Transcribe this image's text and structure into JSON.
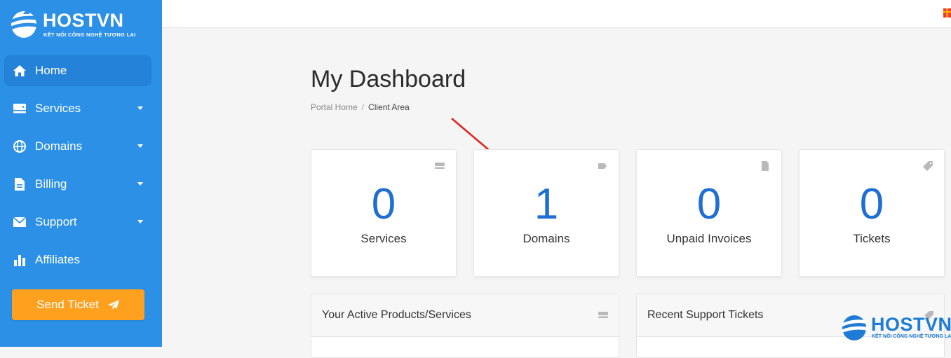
{
  "brand": {
    "name": "HOSTVN",
    "tagline": "KẾT NỐI CÔNG NGHỆ TƯƠNG LAI",
    "primary_color": "#2b90e6",
    "accent_color": "#ffa01f",
    "number_color": "#1f6ed4"
  },
  "sidebar": {
    "items": [
      {
        "label": "Home",
        "icon": "home-icon",
        "active": true
      },
      {
        "label": "Services",
        "icon": "server-icon",
        "has_submenu": true
      },
      {
        "label": "Domains",
        "icon": "globe-icon",
        "has_submenu": true
      },
      {
        "label": "Billing",
        "icon": "file-icon",
        "has_submenu": true
      },
      {
        "label": "Support",
        "icon": "envelope-icon",
        "has_submenu": true
      },
      {
        "label": "Affiliates",
        "icon": "bar-chart-icon"
      }
    ],
    "send_ticket_label": "Send Ticket"
  },
  "main": {
    "title": "My Dashboard",
    "breadcrumb": {
      "home": "Portal Home",
      "separator": "/",
      "current": "Client Area"
    },
    "stats": [
      {
        "value": "0",
        "label": "Services",
        "icon": "server-icon"
      },
      {
        "value": "1",
        "label": "Domains",
        "icon": "tag-icon"
      },
      {
        "value": "0",
        "label": "Unpaid Invoices",
        "icon": "file-icon"
      },
      {
        "value": "0",
        "label": "Tickets",
        "icon": "ticket-tag-icon"
      }
    ],
    "panels": [
      {
        "title": "Your Active Products/Services",
        "icon": "server-icon"
      },
      {
        "title": "Recent Support Tickets",
        "icon": "ticket-tag-icon"
      }
    ]
  }
}
